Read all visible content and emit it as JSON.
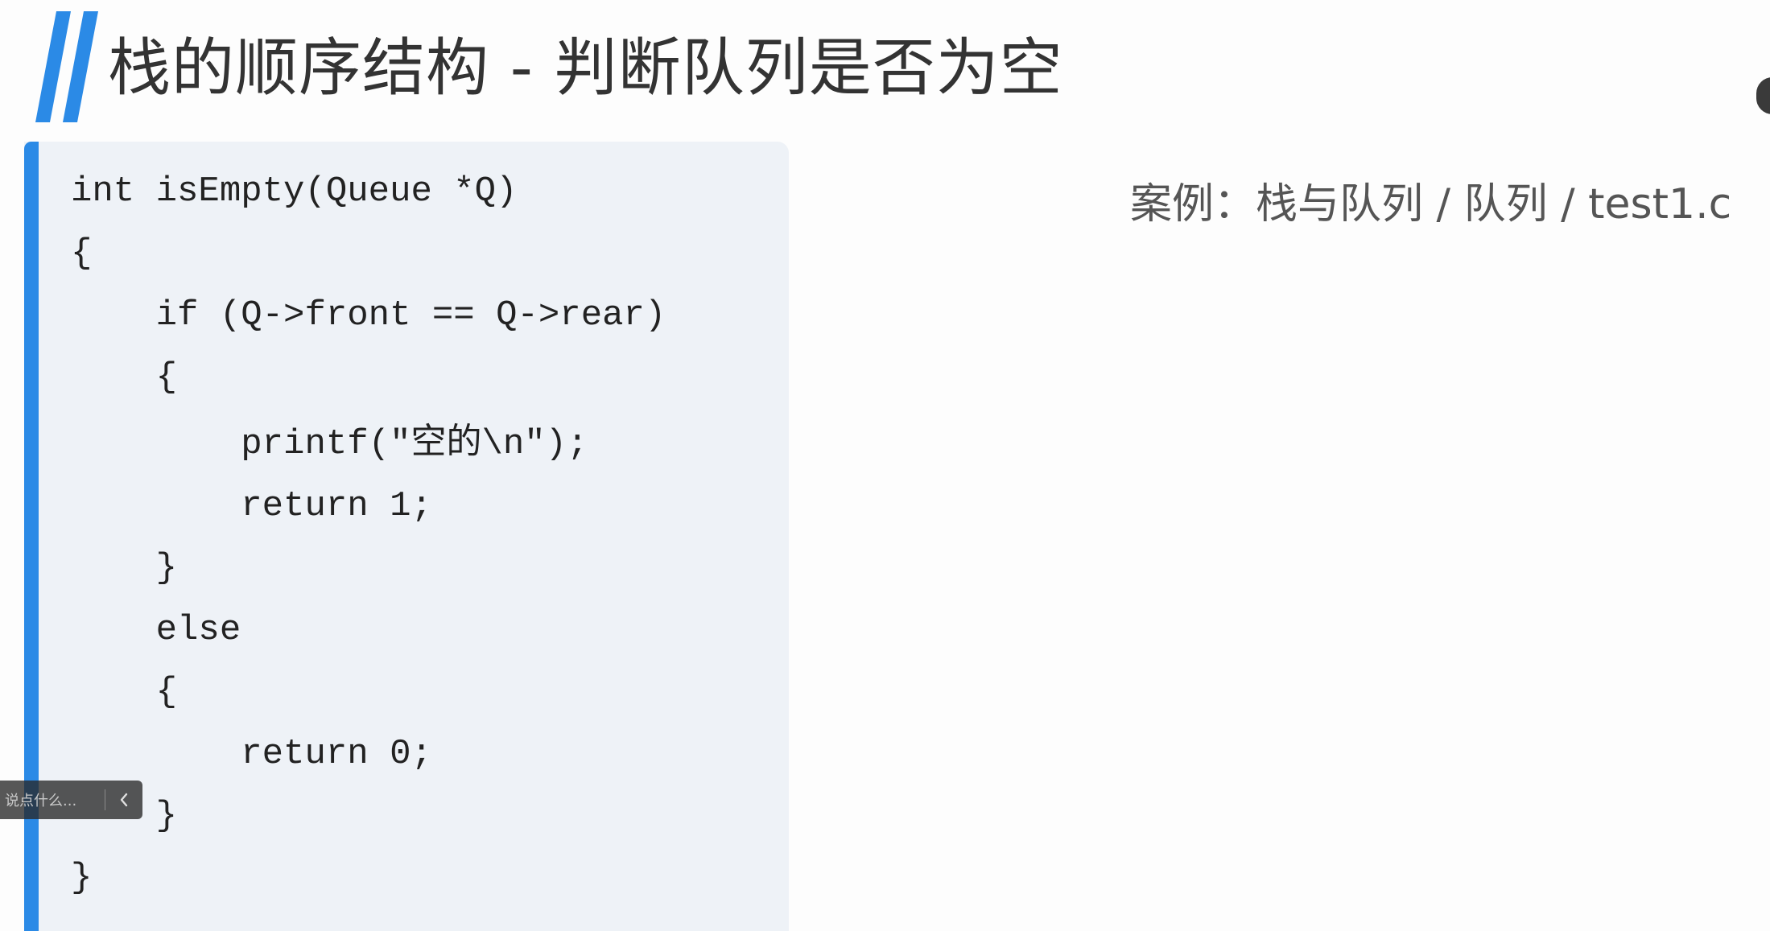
{
  "slide": {
    "title": "栈的顺序结构 - 判断队列是否为空",
    "case_reference": "案例：栈与队列 / 队列 / test1.c",
    "accent_color": "#2b8ae6"
  },
  "code": {
    "lines": [
      "int isEmpty(Queue *Q)",
      "{",
      "    if (Q->front == Q->rear)",
      "    {",
      "        printf(\"空的\\n\");",
      "        return 1;",
      "    }",
      "    else",
      "    {",
      "        return 0;",
      "    }",
      "}"
    ]
  },
  "comment_widget": {
    "placeholder": "说点什么...",
    "collapse_icon": "chevron-left-icon"
  },
  "icons": {
    "title_accent": "double-slash-accent-icon",
    "edge_control": "circle-button-icon"
  }
}
